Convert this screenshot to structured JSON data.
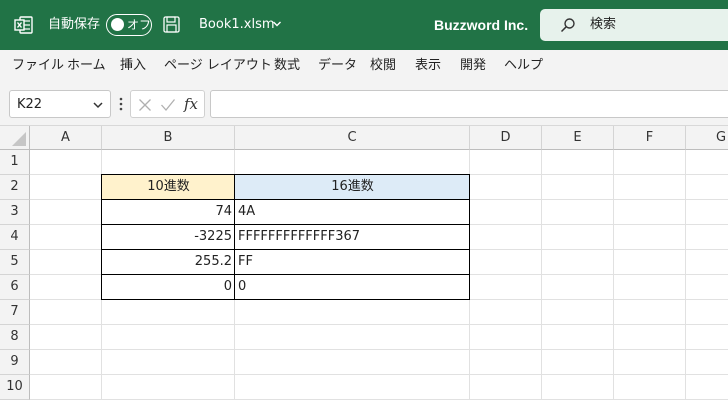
{
  "titlebar": {
    "autosave_label": "自動保存",
    "autosave_state": "オフ",
    "filename": "Book1.xlsm",
    "company": "Buzzword Inc.",
    "search_label": "検索",
    "bg_color": "#217346"
  },
  "menu": [
    "ファイル",
    "ホーム",
    "挿入",
    "ページ レイアウト",
    "数式",
    "データ",
    "校閲",
    "表示",
    "開発",
    "ヘルプ"
  ],
  "formula_bar": {
    "name_box": "K22",
    "fx_label": "fx",
    "formula": ""
  },
  "columns": [
    "A",
    "B",
    "C",
    "D",
    "E",
    "F",
    "G"
  ],
  "rows": [
    "1",
    "2",
    "3",
    "4",
    "5",
    "6",
    "7",
    "8",
    "9",
    "10"
  ],
  "table": {
    "header_decimal": "10進数",
    "header_hex": "16進数",
    "header_decimal_color": "#fff2cc",
    "header_hex_color": "#ddebf7",
    "rows": [
      {
        "decimal": "74",
        "hex": "4A"
      },
      {
        "decimal": "-3225",
        "hex": "FFFFFFFFFFFFF367"
      },
      {
        "decimal": "255.2",
        "hex": "FF"
      },
      {
        "decimal": "0",
        "hex": "0"
      }
    ]
  }
}
